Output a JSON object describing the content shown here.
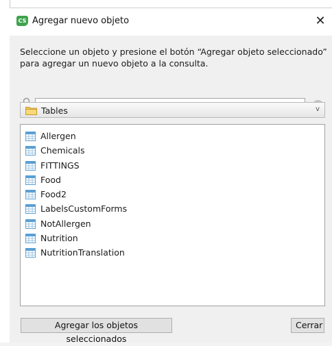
{
  "window": {
    "title": "Agregar nuevo objeto",
    "app_icon_text": "CS",
    "close_glyph": "✕"
  },
  "instructions": "Seleccione un objeto y presione el botón “Agregar objeto seleccionado” para agregar un nuevo objeto a la consulta.",
  "search": {
    "value": "",
    "placeholder": ""
  },
  "category": {
    "selected": "Tables",
    "chevron": "v"
  },
  "objects": [
    {
      "label": "Allergen"
    },
    {
      "label": "Chemicals"
    },
    {
      "label": "FITTINGS"
    },
    {
      "label": "Food"
    },
    {
      "label": "Food2"
    },
    {
      "label": "LabelsCustomForms"
    },
    {
      "label": "NotAllergen"
    },
    {
      "label": "Nutrition"
    },
    {
      "label": "NutritionTranslation"
    }
  ],
  "buttons": {
    "add_label": "Agregar los objetos seleccionados",
    "close_label": "Cerrar"
  },
  "colors": {
    "app_icon": "#3fa34d",
    "folder": "#f2c85b",
    "table_icon": "#5a9fd4"
  }
}
